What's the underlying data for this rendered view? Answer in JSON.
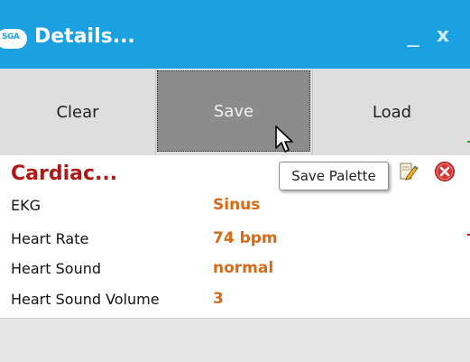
{
  "window": {
    "logo_text": "SGA",
    "title": "Details...",
    "minimize_glyph": "_",
    "close_glyph": "x"
  },
  "toolbar": {
    "clear_label": "Clear",
    "save_label": "Save",
    "load_label": "Load"
  },
  "tooltip": {
    "text": "Save Palette"
  },
  "panel": {
    "title": "Cardiac...",
    "rows": [
      {
        "label": "EKG",
        "value": "Sinus"
      },
      {
        "label": "Heart Rate",
        "value": "74 bpm"
      },
      {
        "label": "Heart Sound",
        "value": "normal"
      },
      {
        "label": "Heart Sound Volume",
        "value": "3"
      }
    ]
  },
  "colors": {
    "titlebar": "#1ba1e2",
    "panel_title": "#b01818",
    "value": "#d86a17",
    "save_pressed": "#8c8c8c"
  },
  "icons": {
    "cursor": "mouse-pointer-icon",
    "edit": "edit-pencil-icon",
    "remove": "close-circle-icon"
  }
}
